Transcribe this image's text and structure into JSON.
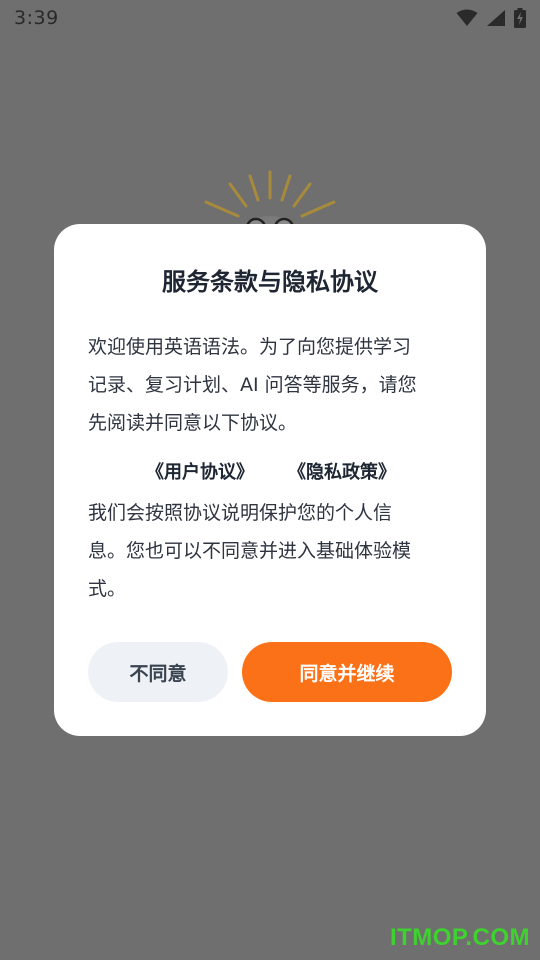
{
  "status_bar": {
    "time": "3:39",
    "icons": [
      "wifi-icon",
      "signal-icon",
      "battery-charging-icon"
    ]
  },
  "dialog": {
    "title": "服务条款与隐私协议",
    "intro_lines": [
      "欢迎使用英语语法。为了向您提供学习",
      "记录、复习计划、AI 问答等服务，请您",
      "先阅读并同意以下协议。"
    ],
    "links": {
      "user_agreement": "《用户协议》",
      "privacy_policy": "《隐私政策》"
    },
    "detail_lines": [
      "我们会按照协议说明保护您的个人信",
      "息。您也可以不同意并进入基础体验模",
      "式。"
    ],
    "buttons": {
      "decline": "不同意",
      "accept": "同意并继续"
    }
  },
  "watermark": "ITMOP.COM",
  "colors": {
    "accent": "#fb7118",
    "overlay": "#6f6f6f",
    "secondary_button": "#eef1f5",
    "watermark": "#3fd12f"
  }
}
